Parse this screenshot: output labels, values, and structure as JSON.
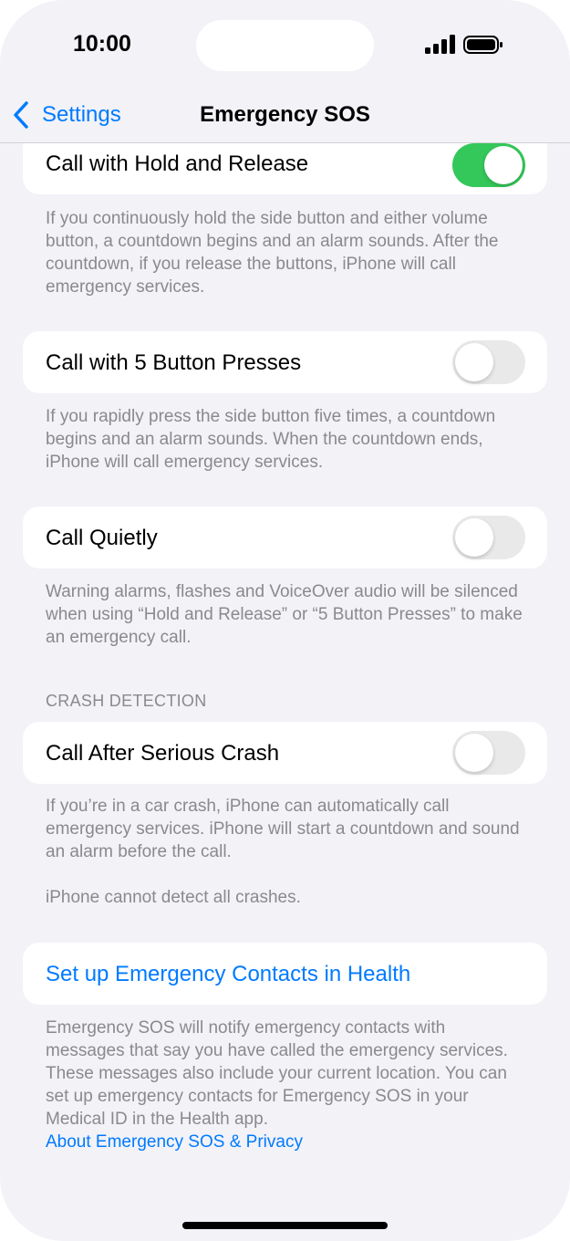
{
  "status_bar": {
    "time": "10:00"
  },
  "nav": {
    "back_label": "Settings",
    "title": "Emergency SOS"
  },
  "hold_release": {
    "label": "Call with Hold and Release",
    "enabled": true,
    "footer": "If you continuously hold the side button and either volume button, a countdown begins and an alarm sounds. After the countdown, if you release the buttons, iPhone will call emergency services."
  },
  "five_presses": {
    "label": "Call with 5 Button Presses",
    "enabled": false,
    "footer": "If you rapidly press the side button five times, a countdown begins and an alarm sounds. When the countdown ends, iPhone will call emergency services."
  },
  "call_quietly": {
    "label": "Call Quietly",
    "enabled": false,
    "footer": "Warning alarms, flashes and VoiceOver audio will be silenced when using “Hold and Release” or “5 Button Presses” to make an emergency call."
  },
  "crash_detection": {
    "header": "CRASH DETECTION",
    "label": "Call After Serious Crash",
    "enabled": false,
    "footer": "If you’re in a car crash, iPhone can automatically call emergency services. iPhone will start a countdown and sound an alarm before the call.",
    "footer2": "iPhone cannot detect all crashes."
  },
  "emergency_contacts": {
    "link_label": "Set up Emergency Contacts in Health",
    "footer": "Emergency SOS will notify emergency contacts with messages that say you have called the emergency services. These messages also include your current location. You can set up emergency contacts for Emergency SOS in your Medical ID in the Health app.",
    "privacy_link": "About Emergency SOS & Privacy"
  },
  "colors": {
    "accent": "#007aff",
    "toggle_on": "#34c759",
    "toggle_off": "#e9e9ea",
    "background": "#f2f2f7"
  }
}
